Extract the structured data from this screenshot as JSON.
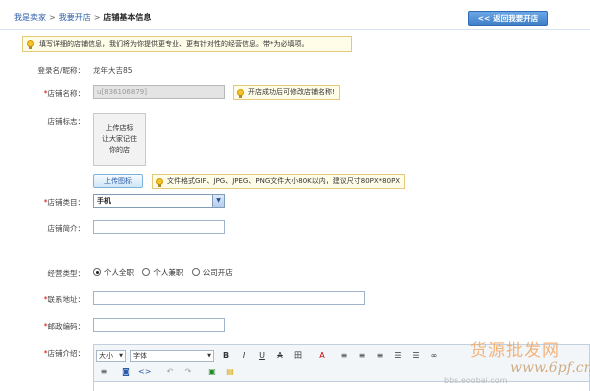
{
  "breadcrumb": {
    "home": "我是卖家",
    "sep1": ">",
    "shop": "我要开店",
    "sep2": ">",
    "current": "店铺基本信息"
  },
  "back_button": {
    "chevron": "<<",
    "label": "返回我要开店"
  },
  "notice": "填写详细的店铺信息，我们将为你提供更专业、更有针对性的经营信息。带*为必填项。",
  "form": {
    "login_label": "登录名/昵称：",
    "login_value": "龙年大吉85",
    "shop_name_req": "*",
    "shop_name_label": "店铺名称：",
    "shop_name_value": "u[836106879]",
    "shop_name_tip": "开店成功后可修改店铺名称!",
    "logo_label": "店铺标志：",
    "logo_placeholder_1": "上传店标",
    "logo_placeholder_2": "让大家记住",
    "logo_placeholder_3": "你的店",
    "upload_button": "上传图标",
    "logo_tip": "文件格式GIF、JPG、JPEG、PNG文件大小80K以内，建议尺寸80PX*80PX",
    "category_req": "*",
    "category_label": "店铺类目：",
    "category_value": "手机",
    "intro_label": "店铺简介：",
    "intro_value": "",
    "business_label": "经营类型：",
    "business_options": [
      "个人全职",
      "个人兼职",
      "公司开店"
    ],
    "business_selected": "个人全职",
    "address_req": "*",
    "address_label": "联系地址：",
    "address_value": "",
    "zip_req": "*",
    "zip_label": "邮政编码：",
    "zip_value": "",
    "desc_req": "*",
    "desc_label": "店铺介绍："
  },
  "editor": {
    "font_size": "大小",
    "font_family": "字体",
    "bold": "B",
    "italic": "I",
    "underline": "U",
    "strike": "A",
    "table": "田",
    "color": "A",
    "align_left": "≡",
    "align_center": "≡",
    "align_right": "≡",
    "list_ordered": "☰",
    "list_bullet": "☰",
    "link": "∞",
    "row2_1": "≡",
    "row2_2": "◙",
    "row2_3": "<>",
    "row2_4": "↶",
    "row2_5": "↷",
    "row2_6": "▣",
    "row2_7": "▤"
  },
  "watermark": {
    "main": "货源批发网",
    "site_a": "www",
    "site_b": "6pf",
    "site_c": ".cn",
    "sub": "bbs.eoobai.com"
  }
}
